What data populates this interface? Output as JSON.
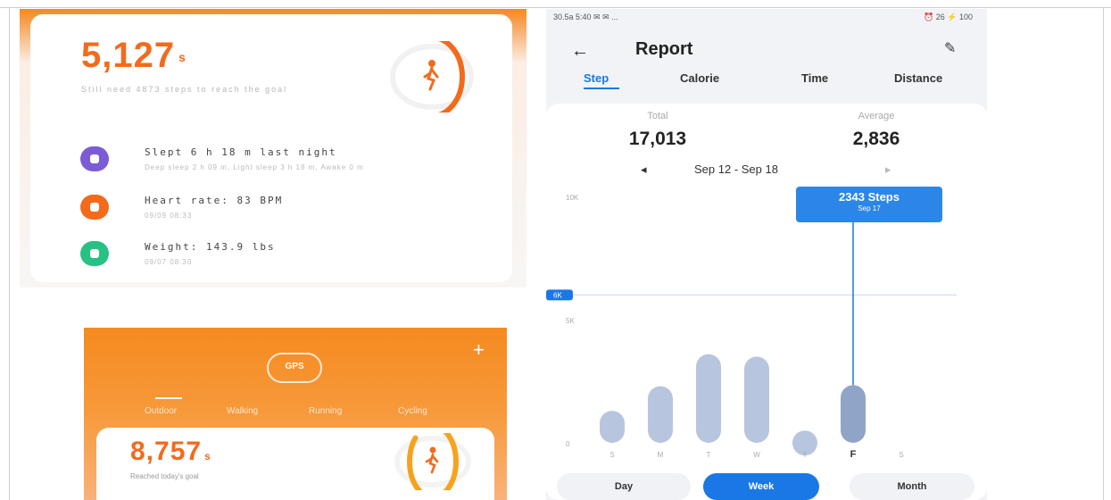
{
  "panel1": {
    "steps": "5,127",
    "steps_suffix": "s",
    "subtitle": "Still need 4873 steps to reach the goal",
    "rows": [
      {
        "title": "Slept 6 h 18 m last night",
        "sub": "Deep sleep 2 h 09 m, Light sleep 3 h 18 m, Awake 0 m",
        "color": "#7b5cd6",
        "icon": "moon-icon"
      },
      {
        "title": "Heart rate: 83 BPM",
        "sub": "09/09 08:33",
        "color": "#f26b1d",
        "icon": "heart-icon"
      },
      {
        "title": "Weight: 143.9 lbs",
        "sub": "09/07 08:30",
        "color": "#27c183",
        "icon": "scale-icon"
      }
    ],
    "ring_progress": 0.51
  },
  "panel2": {
    "gps_label": "GPS",
    "plus": "+",
    "tabs": [
      "Outdoor",
      "Walking",
      "Running",
      "Cycling"
    ],
    "steps": "8,757",
    "steps_suffix": "s",
    "subtitle": "Reached today's goal",
    "ring_progress": 0.88
  },
  "panel3": {
    "status_left": "30.5a 5:40 ✉ ✉ ...",
    "status_right": "⏰ 26 ⚡ 100",
    "back": "←",
    "title": "Report",
    "edit": "✎",
    "tabs": [
      "Step",
      "Calorie",
      "Time",
      "Distance"
    ],
    "total_label": "Total",
    "total_value": "17,013",
    "avg_label": "Average",
    "avg_value": "2,836",
    "prev": "◂",
    "next": "▸",
    "date_range": "Sep 12 - Sep 18",
    "tooltip_main": "2343 Steps",
    "tooltip_sub": "Sep 17",
    "segments": [
      "Day",
      "Week",
      "Month"
    ],
    "active_segment": "Week"
  },
  "chart_data": {
    "type": "bar",
    "categories": [
      "S",
      "M",
      "T",
      "W",
      "T",
      "F",
      "S"
    ],
    "values": [
      1300,
      2300,
      3600,
      3500,
      500,
      2343,
      0
    ],
    "highlight_index": 5,
    "ylim": [
      0,
      10000
    ],
    "y_ticks": [
      "10K",
      "5K",
      "0"
    ],
    "goal_line_label": "6K",
    "goal_line_value": 6000,
    "bar_color": "#b8c5de",
    "highlight_color": "#8fa4c7",
    "accent": "#1a78e6"
  }
}
